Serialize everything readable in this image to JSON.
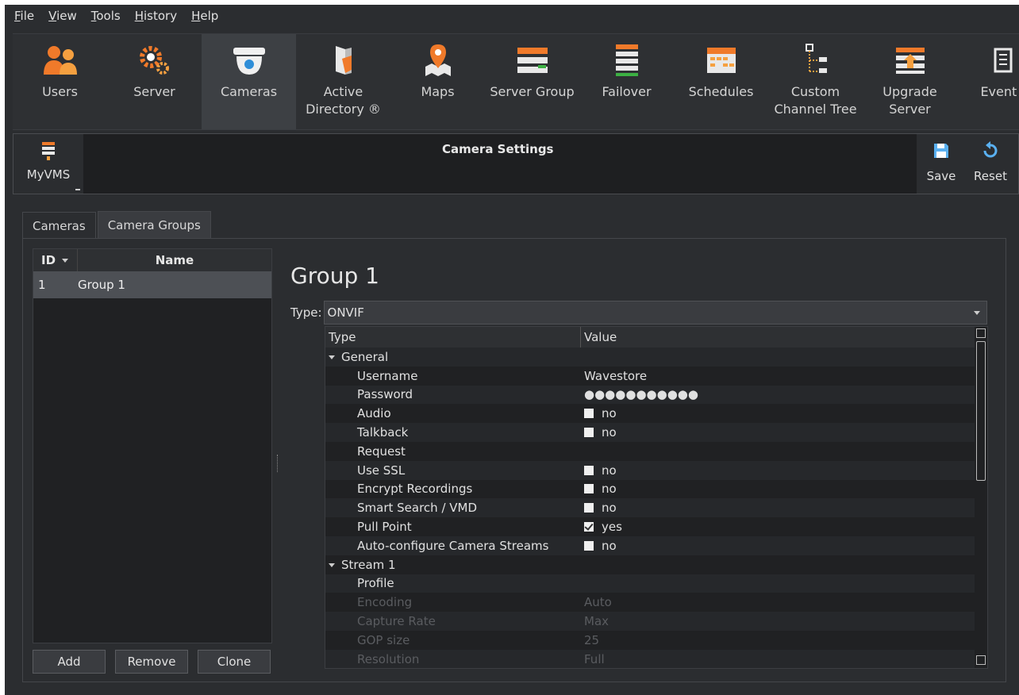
{
  "menu": [
    {
      "label": "File",
      "u": "F",
      "rest": "ile"
    },
    {
      "label": "View",
      "u": "V",
      "rest": "iew"
    },
    {
      "label": "Tools",
      "u": "T",
      "rest": "ools"
    },
    {
      "label": "History",
      "u": "H",
      "rest": "istory"
    },
    {
      "label": "Help",
      "u": "H",
      "rest": "elp"
    }
  ],
  "toolbar": [
    {
      "label": "Users",
      "icon": "users-icon"
    },
    {
      "label": "Server",
      "icon": "server-gear-icon"
    },
    {
      "label": "Cameras",
      "icon": "dome-camera-icon",
      "active": true
    },
    {
      "label": "Active\nDirectory ®",
      "icon": "active-directory-icon"
    },
    {
      "label": "Maps",
      "icon": "map-pin-icon"
    },
    {
      "label": "Server Group",
      "icon": "server-group-icon"
    },
    {
      "label": "Failover",
      "icon": "failover-icon"
    },
    {
      "label": "Schedules",
      "icon": "calendar-icon"
    },
    {
      "label": "Custom\nChannel Tree",
      "icon": "channel-tree-icon"
    },
    {
      "label": "Upgrade\nServer",
      "icon": "upgrade-server-icon"
    },
    {
      "label": "Event F",
      "icon": "event-log-icon"
    }
  ],
  "settings": {
    "node_label": "MyVMS",
    "title": "Camera Settings",
    "save_label": "Save",
    "reset_label": "Reset"
  },
  "tabs": [
    "Cameras",
    "Camera Groups"
  ],
  "group_list": {
    "col_id": "ID",
    "col_name": "Name",
    "rows": [
      {
        "id": "1",
        "name": "Group 1"
      }
    ],
    "add_label": "Add",
    "remove_label": "Remove",
    "clone_label": "Clone"
  },
  "group": {
    "title": "Group 1",
    "type_label": "Type:",
    "type_value": "ONVIF"
  },
  "props": {
    "col_type": "Type",
    "col_value": "Value",
    "rows": [
      {
        "key": "General",
        "section": true
      },
      {
        "key": "Username",
        "value": "Wavestore"
      },
      {
        "key": "Password",
        "value": "●●●●●●●●●●●"
      },
      {
        "key": "Audio",
        "value": "no",
        "check": false
      },
      {
        "key": "Talkback",
        "value": "no",
        "check": false
      },
      {
        "key": "Request",
        "value": ""
      },
      {
        "key": "Use SSL",
        "value": "no",
        "check": false
      },
      {
        "key": "Encrypt Recordings",
        "value": "no",
        "check": false
      },
      {
        "key": "Smart Search / VMD",
        "value": "no",
        "check": false
      },
      {
        "key": "Pull Point",
        "value": "yes",
        "check": true
      },
      {
        "key": "Auto-configure Camera Streams",
        "value": "no",
        "check": false
      },
      {
        "key": "Stream 1",
        "section": true
      },
      {
        "key": "Profile",
        "value": ""
      },
      {
        "key": "Encoding",
        "value": "Auto",
        "disabled": true
      },
      {
        "key": "Capture Rate",
        "value": "Max",
        "disabled": true
      },
      {
        "key": "GOP size",
        "value": "25",
        "disabled": true
      },
      {
        "key": "Resolution",
        "value": "Full",
        "disabled": true
      }
    ]
  },
  "colors": {
    "background": "#2b2d30",
    "accent_orange": "#f07a2a",
    "selected_row": "#4d5055"
  }
}
